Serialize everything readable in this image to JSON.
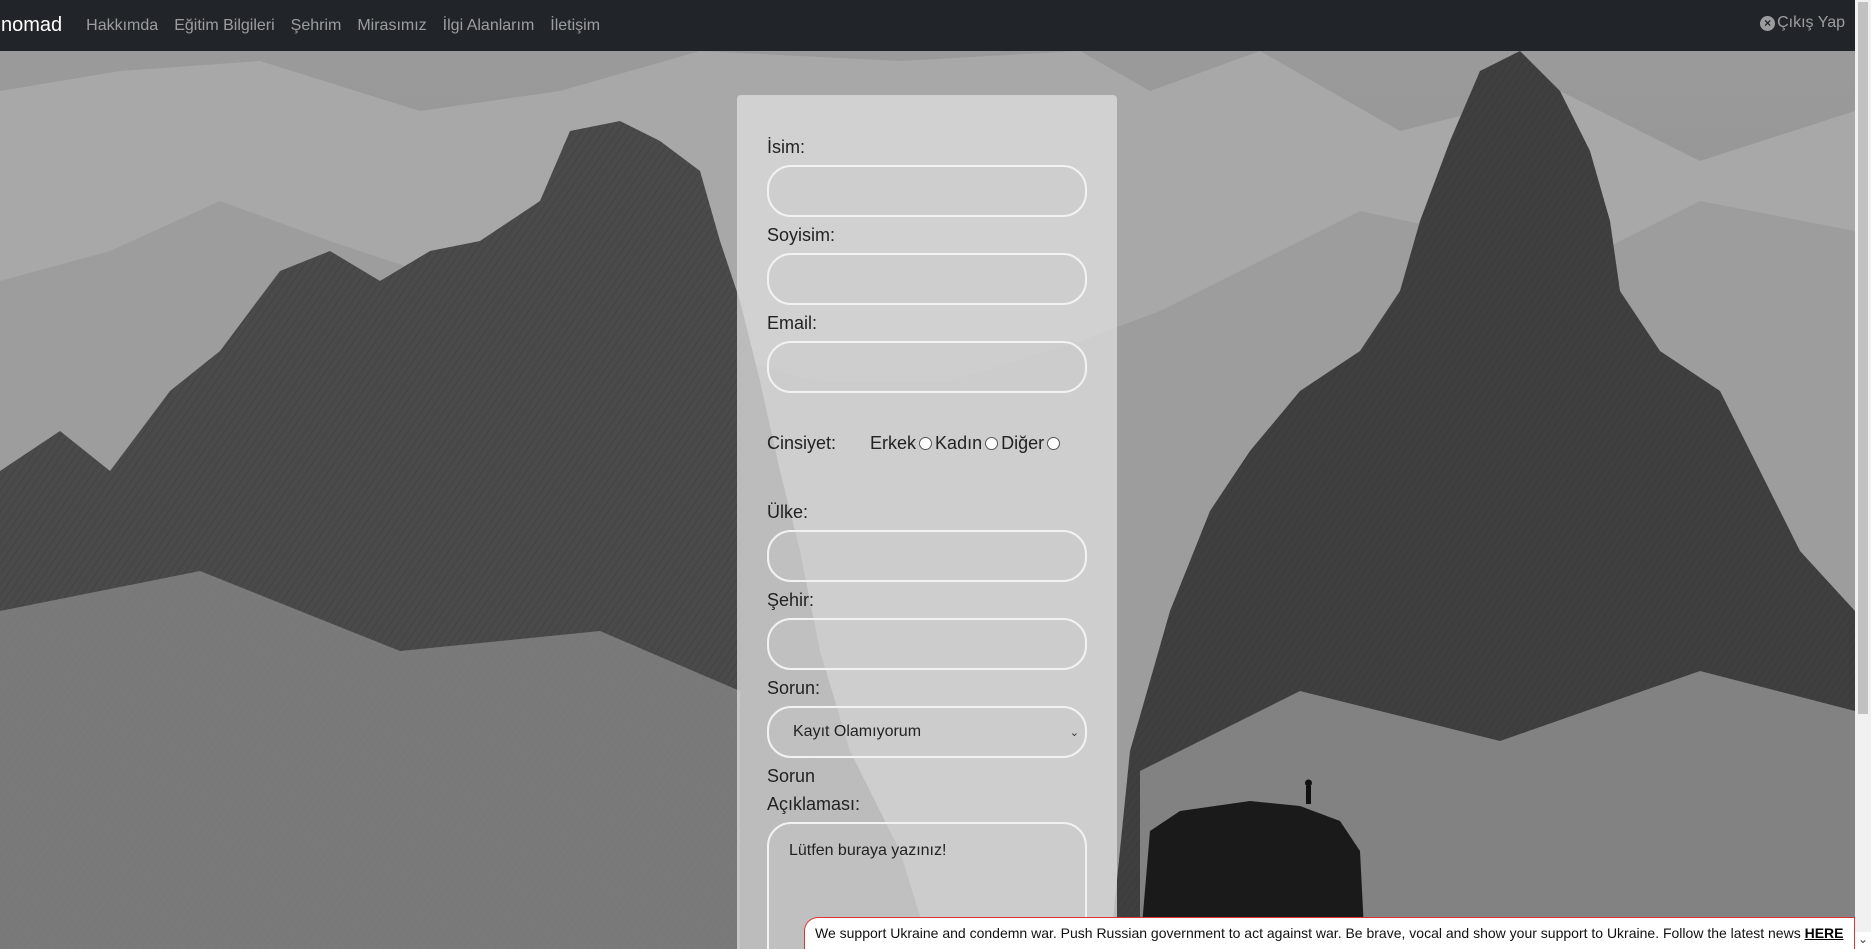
{
  "navbar": {
    "brand": "nomad",
    "links": [
      "Hakkımda",
      "Eğitim Bilgileri",
      "Şehrim",
      "Mirasımız",
      "İlgi Alanlarım",
      "İletişim"
    ],
    "logout_label": "Çıkış Yap"
  },
  "form": {
    "first_name_label": "İsim:",
    "last_name_label": "Soyisim:",
    "email_label": "Email:",
    "gender_label": "Cinsiyet:",
    "gender_options": [
      "Erkek",
      "Kadın",
      "Diğer"
    ],
    "country_label": "Ülke:",
    "city_label": "Şehir:",
    "issue_label": "Sorun:",
    "issue_selected": "Kayıt Olamıyorum",
    "description_label_1": "Sorun",
    "description_label_2": "Açıklaması:",
    "description_placeholder": "Lütfen buraya yazınız!"
  },
  "banner": {
    "text": "We support Ukraine and condemn war. Push Russian government to act against war. Be brave, vocal and show your support to Ukraine. Follow the latest news ",
    "link": "HERE"
  },
  "icons": {
    "logout": "close-circle-icon",
    "select_arrow": "chevron-down-icon"
  },
  "colors": {
    "navbar_bg": "#212529",
    "card_bg": "#dcdcdc",
    "banner_border": "#dd3333"
  }
}
